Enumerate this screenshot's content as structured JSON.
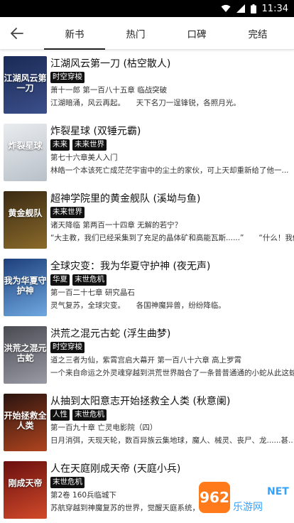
{
  "status_bar": {
    "time": "11:34",
    "icons": [
      "wifi-icon",
      "signal-icon",
      "battery-icon"
    ]
  },
  "header": {
    "back_icon": "arrow-left-icon",
    "tabs": [
      {
        "label": "新书",
        "active": true
      },
      {
        "label": "热门",
        "active": false
      },
      {
        "label": "口碑",
        "active": false
      },
      {
        "label": "完结",
        "active": false
      }
    ]
  },
  "books": [
    {
      "title": "江湖风云第一刀 (枯空散人)",
      "tags": [
        "时空穿梭"
      ],
      "chapter": "萧十一郎 第一百八十五章 临战突破",
      "desc": "江湖暗涌，风云再起。　　天下名刀一逞锋锐，各照月光。",
      "cover_text": "江湖风云第一刀",
      "cover_colors": [
        "#1a2a55",
        "#3b4f8a"
      ]
    },
    {
      "title": "炸裂星球 (双锤元霸)",
      "tags": [
        "未来",
        "未来世界"
      ],
      "chapter": "第七十六章美人入门",
      "desc": "林皓一个本该死亡成茫茫宇宙中的尘土的家伙，可上天却重新给了他一...",
      "cover_text": "炸裂星球",
      "cover_colors": [
        "#e9ecef",
        "#b8c0c8"
      ]
    },
    {
      "title": "超神学院里的黄金舰队 (溪坳与鱼)",
      "tags": [
        "未来世界"
      ],
      "chapter": "诸天降临 第两百一十四章 无解的若宁？",
      "desc": "“大主教，我们已经采集到了充足的晶体矿和高能瓦斯......”　　“什么！我们",
      "cover_text": "黄金舰队",
      "cover_colors": [
        "#3a2a14",
        "#8a6a2a"
      ]
    },
    {
      "title": "全球灾变：我为华夏守护神 (夜无声)",
      "tags": [
        "华夏",
        "末世危机"
      ],
      "chapter": "第一百二十七章 研究晶石",
      "desc": "灵气复苏，全球灾变。　　各国神魔异兽，纷纷降临。",
      "cover_text": "我为华夏守护神",
      "cover_colors": [
        "#1d3f7a",
        "#6fa8e0"
      ]
    },
    {
      "title": "洪荒之混元古蛇 (浮生曲梦)",
      "tags": [
        "时空穿梭"
      ],
      "chapter": "道之三者为仙，紫霄宫启大幕开 第一百八十六章 高上罗霄",
      "desc": "一个来自命运之外灵魂穿越到洪荒世界融合了一条普普通通的小蛇从此这蛇...",
      "cover_text": "洪荒之混元古蛇",
      "cover_colors": [
        "#4a4a52",
        "#9a9aa6"
      ]
    },
    {
      "title": "从抽到太阳意志开始拯救全人类 (秋意阑)",
      "tags": [
        "人性",
        "末世危机"
      ],
      "chapter": "第一百九十章 亡灵电影院（四）",
      "desc": "日月消弭，天现天轮，数百异族云集地球，魔人、械灵、丧尸、龙......甚...",
      "cover_text": "开始拯救全人类",
      "cover_colors": [
        "#2a1410",
        "#b0441e"
      ]
    },
    {
      "title": "人在天庭刚成天帝 (天庭小兵)",
      "tags": [
        "末世危机"
      ],
      "chapter": "第2卷 160兵临城下",
      "desc": "苏航穿越到神魔复苏的世界，觉醒天庭系统，",
      "cover_text": "刚成天帝",
      "cover_colors": [
        "#6a0f0f",
        "#d14a2a"
      ]
    }
  ],
  "watermark": {
    "logo": "962",
    "net": "NET",
    "sub": "乐游网"
  }
}
